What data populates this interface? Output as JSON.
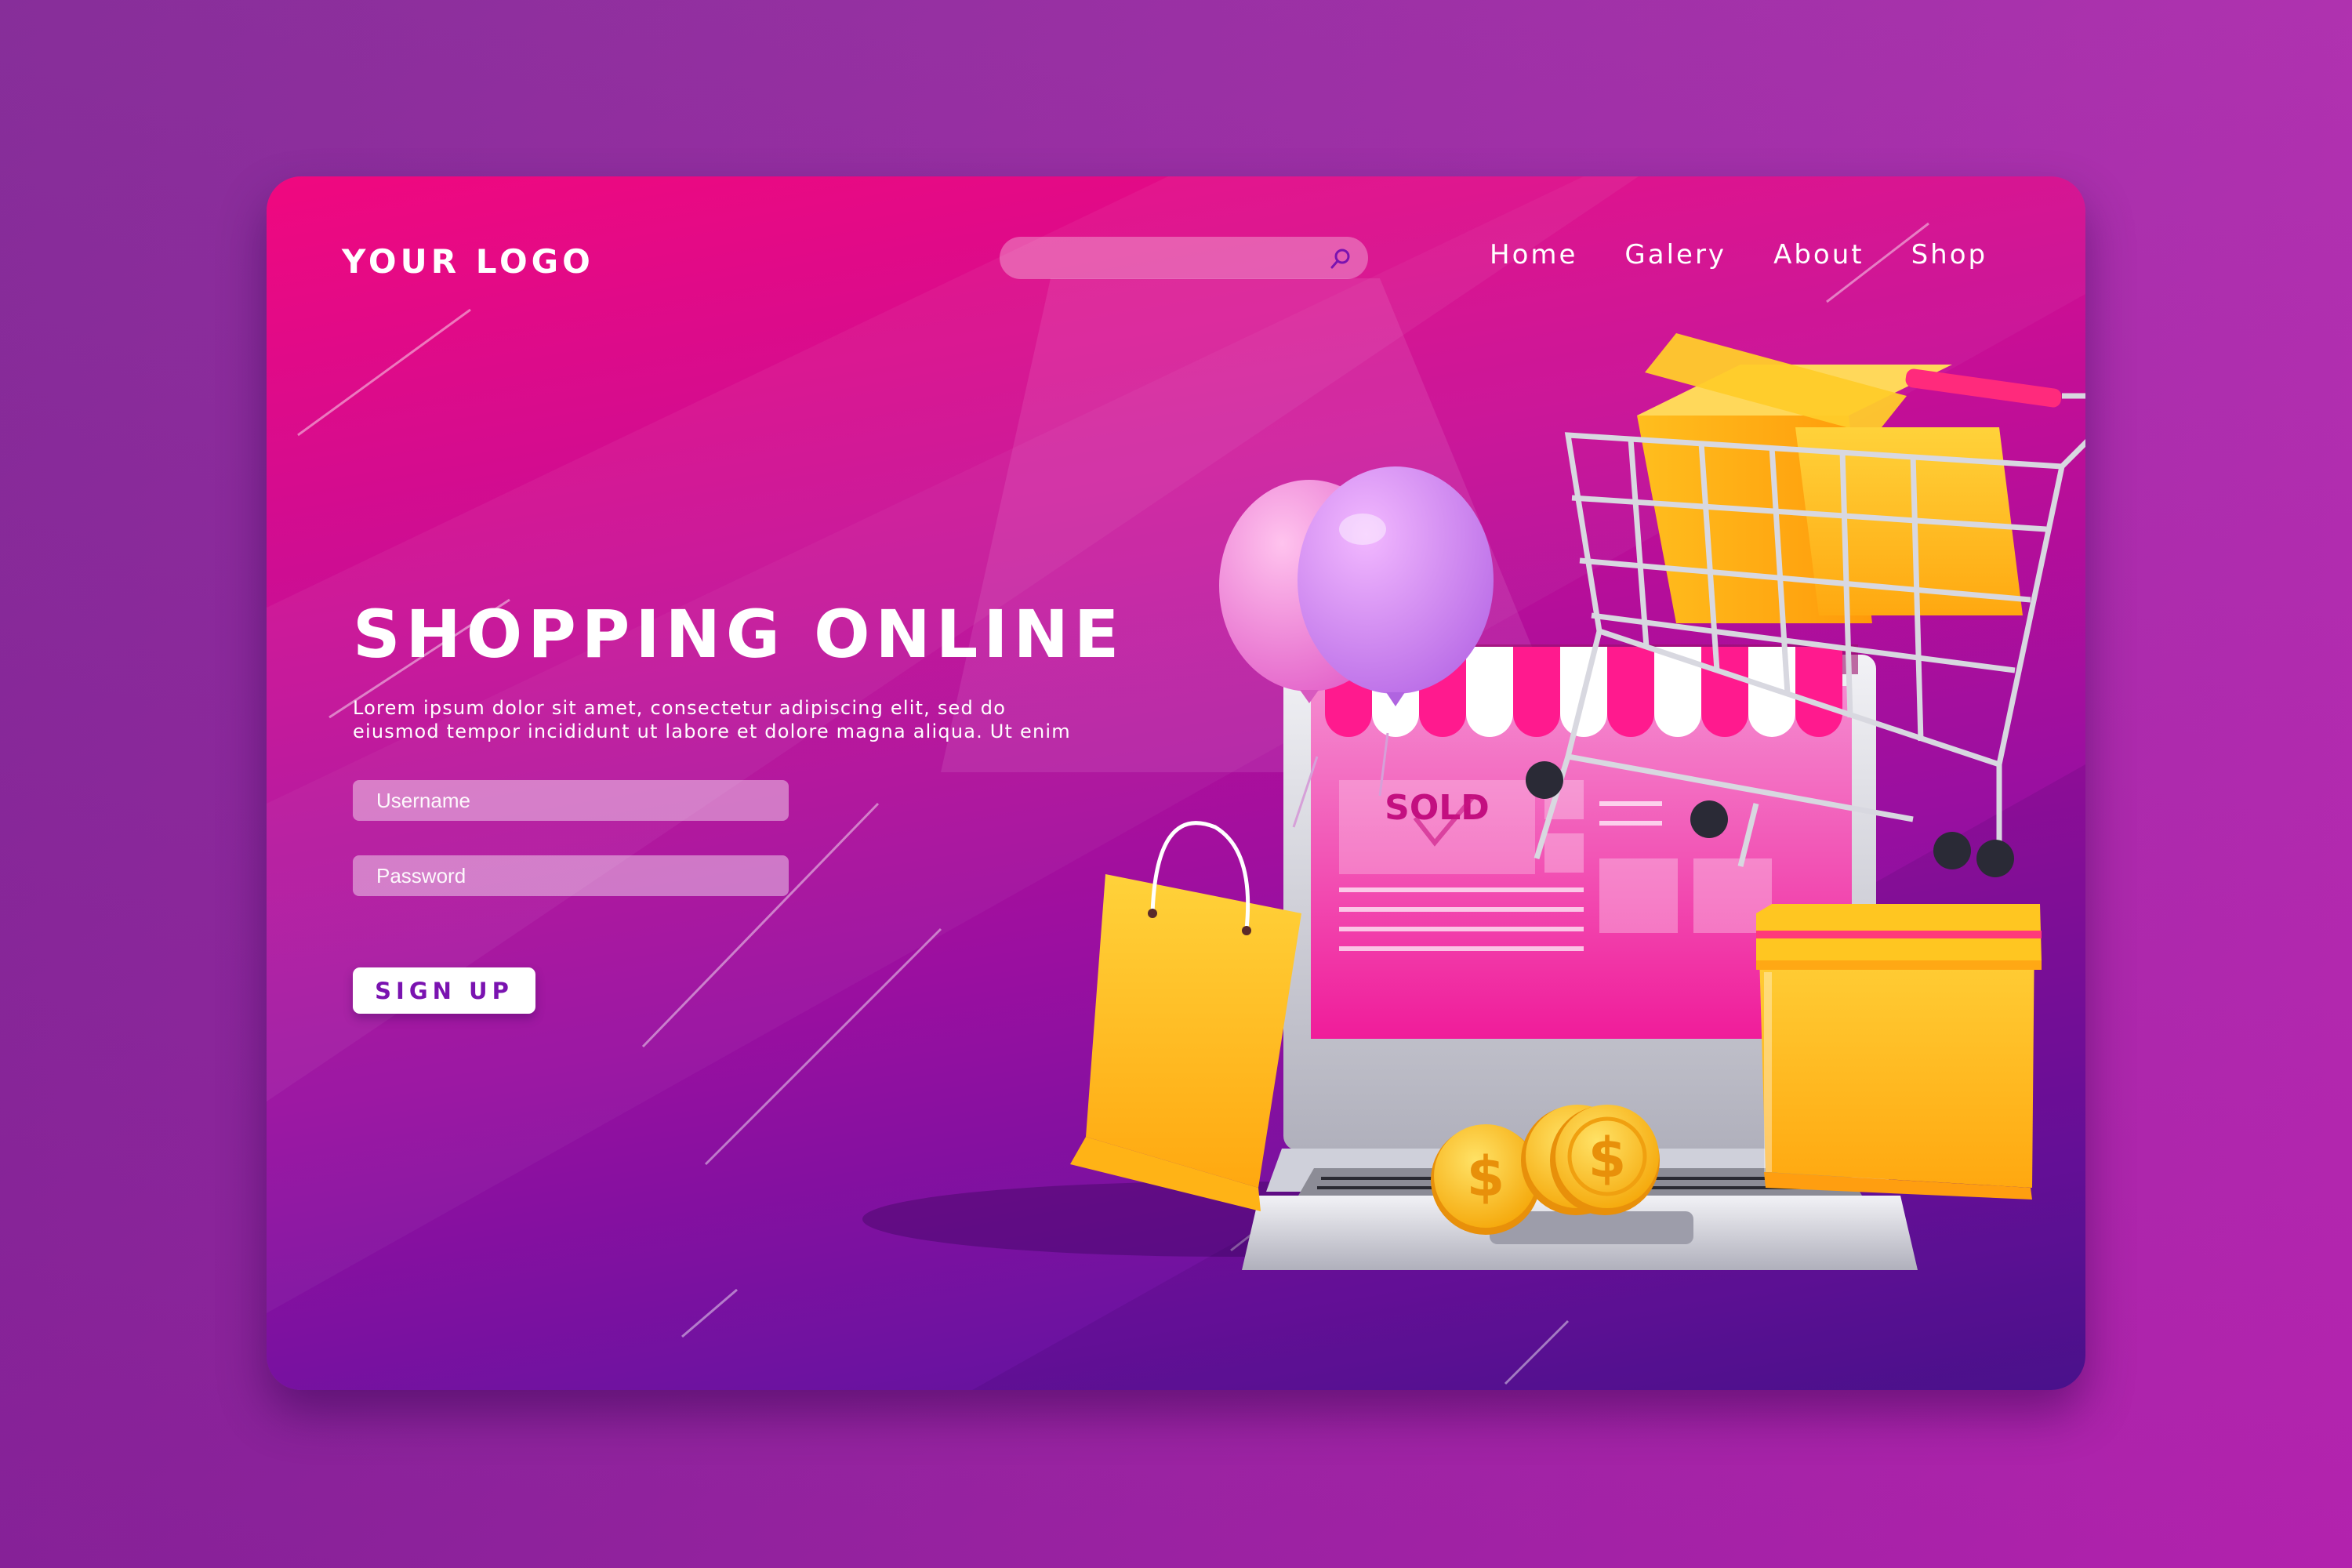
{
  "logo": "YOUR LOGO",
  "search": {
    "placeholder": ""
  },
  "nav": [
    "Home",
    "Galery",
    "About",
    "Shop"
  ],
  "hero": {
    "title": "SHOPPING ONLINE",
    "body_line1": "Lorem ipsum dolor sit amet, consectetur adipiscing elit, sed do",
    "body_line2": "eiusmod tempor incididunt ut labore et dolore magna aliqua. Ut enim"
  },
  "form": {
    "username_placeholder": "Username",
    "password_placeholder": "Password",
    "signup_label": "SIGN UP"
  },
  "illustration": {
    "sold_label": "SOLD",
    "coin_symbol": "$"
  },
  "colors": {
    "card_top": "#f0087f",
    "card_bottom": "#4e1493",
    "accent_yellow": "#ffc21a",
    "button_text": "#7a13b0"
  }
}
